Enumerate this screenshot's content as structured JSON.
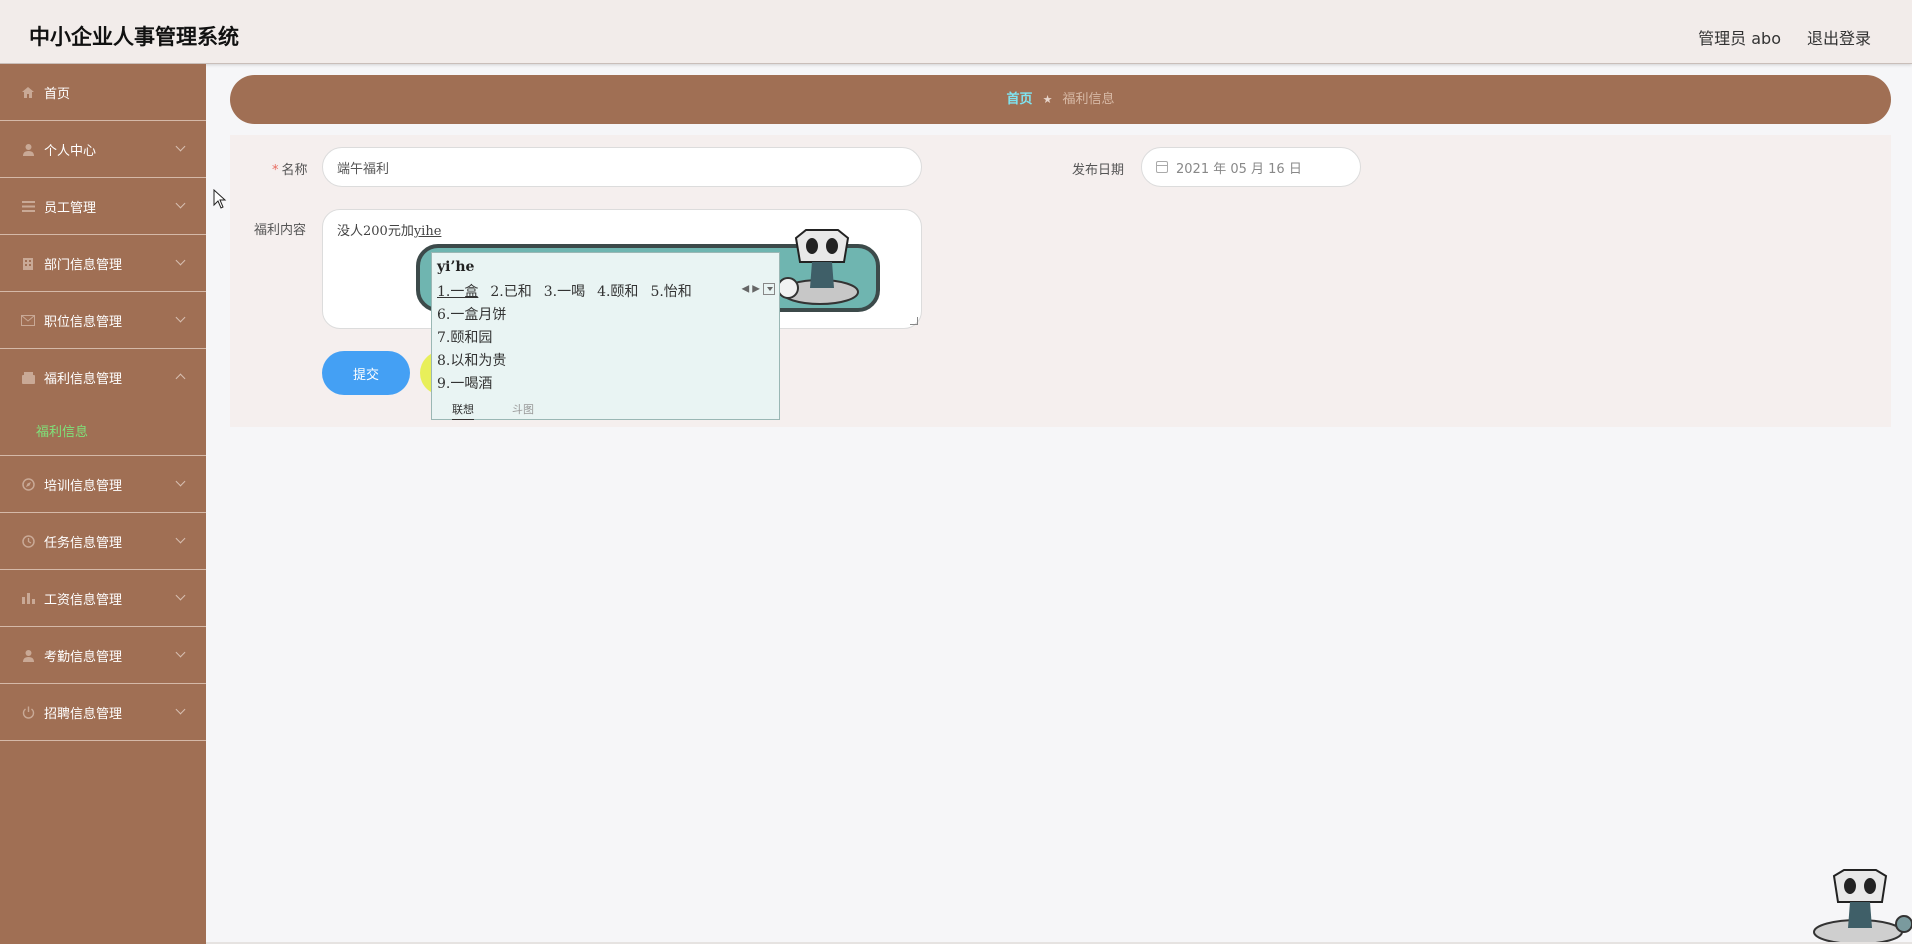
{
  "header": {
    "title": "中小企业人事管理系统",
    "user": "管理员 abo",
    "logout": "退出登录"
  },
  "sidebar": {
    "items": [
      {
        "label": "首页",
        "icon": "home-icon"
      },
      {
        "label": "个人中心",
        "icon": "user-icon"
      },
      {
        "label": "员工管理",
        "icon": "list-icon"
      },
      {
        "label": "部门信息管理",
        "icon": "building-icon"
      },
      {
        "label": "职位信息管理",
        "icon": "mail-icon"
      },
      {
        "label": "福利信息管理",
        "icon": "gift-icon",
        "expanded": true,
        "sub": "福利信息"
      },
      {
        "label": "培训信息管理",
        "icon": "compass-icon"
      },
      {
        "label": "任务信息管理",
        "icon": "clock-icon"
      },
      {
        "label": "工资信息管理",
        "icon": "bar-chart-icon"
      },
      {
        "label": "考勤信息管理",
        "icon": "user-icon"
      },
      {
        "label": "招聘信息管理",
        "icon": "power-icon"
      }
    ]
  },
  "breadcrumb": {
    "home": "首页",
    "current": "福利信息"
  },
  "form": {
    "name_label": "名称",
    "name_value": "端午福利",
    "date_label": "发布日期",
    "date_value": "2021 年 05 月 16 日",
    "content_label": "福利内容",
    "content_value": "没人200元加",
    "content_composing": "yihe",
    "submit_label": "提交"
  },
  "ime": {
    "pinyin": "yi’he",
    "row1": [
      "1.一盒",
      "2.已和",
      "3.一喝",
      "4.颐和",
      "5.怡和"
    ],
    "more": [
      "6.一盒月饼",
      "7.颐和园",
      "8.以和为贵",
      "9.一喝酒"
    ],
    "tab_active": "联想",
    "tab_other": "斗图"
  },
  "colors": {
    "sidebar": "#a06f54",
    "accent_green": "#7fe37a",
    "submit": "#44a0f4"
  }
}
